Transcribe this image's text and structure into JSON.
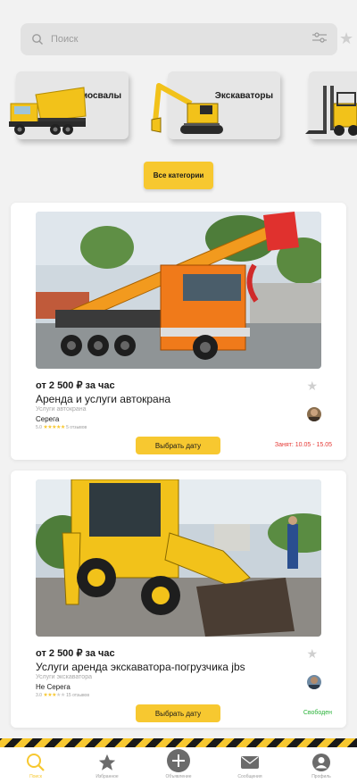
{
  "search": {
    "placeholder": "Поиск",
    "icon": "search-icon",
    "filter_icon": "filter-icon"
  },
  "favorite_icon": "star-icon",
  "categories": [
    {
      "label": "Самосвалы",
      "icon": "dump-truck-image"
    },
    {
      "label": "Экскаваторы",
      "icon": "excavator-image"
    },
    {
      "label": "",
      "icon": "forklift-image"
    }
  ],
  "all_categories_label": "Все категории",
  "listings": [
    {
      "price": "от 2 500 ₽ за час",
      "title": "Аренда и услуги автокрана",
      "subtitle": "Услуги автокрана",
      "author": "Серега",
      "rating": "5.0",
      "rating_stars": 5,
      "reviews": "5 отзывов",
      "button": "Выбрать дату",
      "status": "Занят: 10.05 - 15.05",
      "status_color": "#e53935"
    },
    {
      "price": "от 2 500 ₽ за час",
      "title": "Услуги аренда экскаватора-погрузчика jbs",
      "subtitle": "Услуги экскаватора",
      "author": "Не Серега",
      "rating": "3.0",
      "rating_stars": 3,
      "reviews": "15 отзывов",
      "button": "Выбрать дату",
      "status": "Свободен",
      "status_color": "#2bb33a"
    }
  ],
  "tabs": [
    {
      "label": "Поиск",
      "icon": "search-icon",
      "active": true
    },
    {
      "label": "Избранное",
      "icon": "star-icon",
      "active": false
    },
    {
      "label": "Объявление",
      "icon": "plus-circle-icon",
      "active": false
    },
    {
      "label": "Сообщения",
      "icon": "mail-icon",
      "active": false
    },
    {
      "label": "Профиль",
      "icon": "user-icon",
      "active": false
    }
  ],
  "colors": {
    "accent": "#f7c830",
    "busy": "#e53935",
    "free": "#2bb33a"
  }
}
